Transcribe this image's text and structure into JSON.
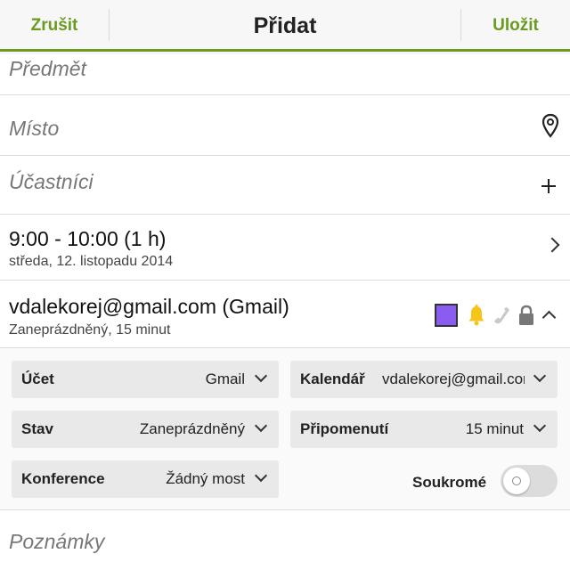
{
  "titlebar": {
    "cancel": "Zrušit",
    "title": "Přidat",
    "save": "Uložit"
  },
  "fields": {
    "subject_placeholder": "Předmět",
    "place_placeholder": "Místo",
    "attendees_placeholder": "Účastníci",
    "notes_placeholder": "Poznámky"
  },
  "time": {
    "range": "9:00 - 10:00 (1 h)",
    "date": "středa, 12. listopadu 2014"
  },
  "account": {
    "title": "vdalekorej@gmail.com (Gmail)",
    "summary": "Zaneprázdněný, 15 minut"
  },
  "details": {
    "account_label": "Účet",
    "account_value": "Gmail",
    "calendar_label": "Kalendář",
    "calendar_value": "vdalekorej@gmail.com",
    "status_label": "Stav",
    "status_value": "Zaneprázdněný",
    "reminder_label": "Připomenutí",
    "reminder_value": "15 minut",
    "conference_label": "Konference",
    "conference_value": "Žádný most",
    "private_label": "Soukromé"
  },
  "colors": {
    "accent": "#6a9a1f",
    "calendar": "#8a5cf0",
    "bell": "#f5c518"
  }
}
